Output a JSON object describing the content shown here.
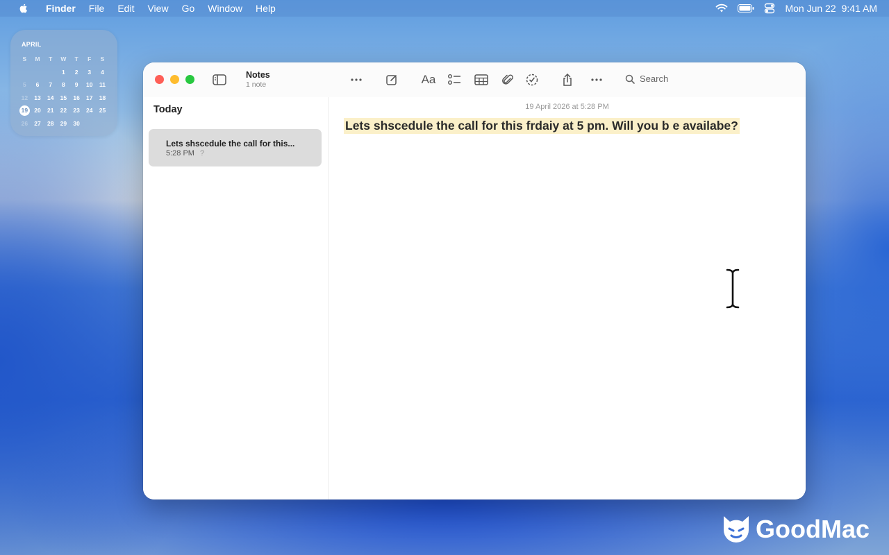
{
  "menubar": {
    "app_name": "Finder",
    "menus": [
      "File",
      "Edit",
      "View",
      "Go",
      "Window",
      "Help"
    ],
    "date": "Mon Jun 22",
    "time": "9:41 AM"
  },
  "calendar_widget": {
    "month": "APRIL",
    "weekdays": [
      "S",
      "M",
      "T",
      "W",
      "T",
      "F",
      "S"
    ],
    "rows": [
      [
        "",
        "",
        "",
        "1",
        "2",
        "3",
        "4"
      ],
      [
        "5",
        "6",
        "7",
        "8",
        "9",
        "10",
        "11"
      ],
      [
        "12",
        "13",
        "14",
        "15",
        "16",
        "17",
        "18"
      ],
      [
        "19",
        "20",
        "21",
        "22",
        "23",
        "24",
        "25"
      ],
      [
        "26",
        "27",
        "28",
        "29",
        "30",
        "",
        ""
      ]
    ],
    "today": "19"
  },
  "window": {
    "title": "Notes",
    "subtitle": "1 note",
    "search_placeholder": "Search"
  },
  "sidebar": {
    "section": "Today",
    "notes": [
      {
        "title": "Lets shscedule the call for this...",
        "time": "5:28 PM",
        "preview": "?"
      }
    ]
  },
  "editor": {
    "date": "19 April 2026 at 5:28 PM",
    "text": "Lets shscedule the call for this frdaiy at 5 pm. Will you b e availabe?"
  },
  "watermark": {
    "text": "GoodMac"
  }
}
